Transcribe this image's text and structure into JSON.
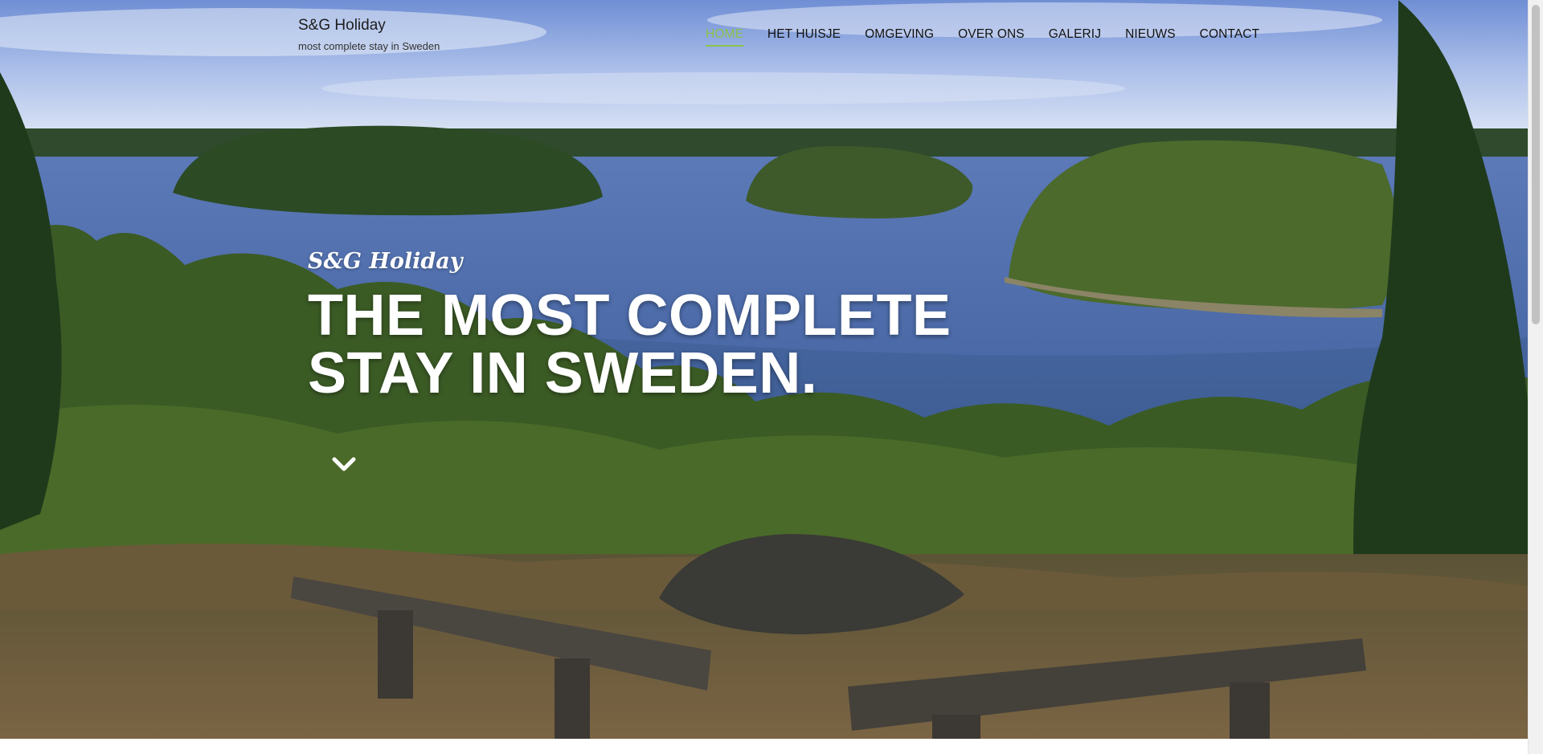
{
  "site": {
    "brand_name": "S&G Holiday",
    "brand_tagline": "most complete stay in Sweden"
  },
  "nav": {
    "items": [
      {
        "label": "HOME",
        "active": true
      },
      {
        "label": "HET HUISJE",
        "active": false
      },
      {
        "label": "OMGEVING",
        "active": false
      },
      {
        "label": "OVER ONS",
        "active": false
      },
      {
        "label": "GALERIJ",
        "active": false
      },
      {
        "label": "NIEUWS",
        "active": false
      },
      {
        "label": "CONTACT",
        "active": false
      }
    ]
  },
  "hero": {
    "script_title": "S&G Holiday",
    "headline_line1": "THE MOST COMPLETE",
    "headline_line2": "STAY IN SWEDEN.",
    "scroll_icon": "chevron-down-icon"
  },
  "colors": {
    "accent": "#8bc34a",
    "nav_text": "#111111",
    "hero_text": "#ffffff"
  }
}
